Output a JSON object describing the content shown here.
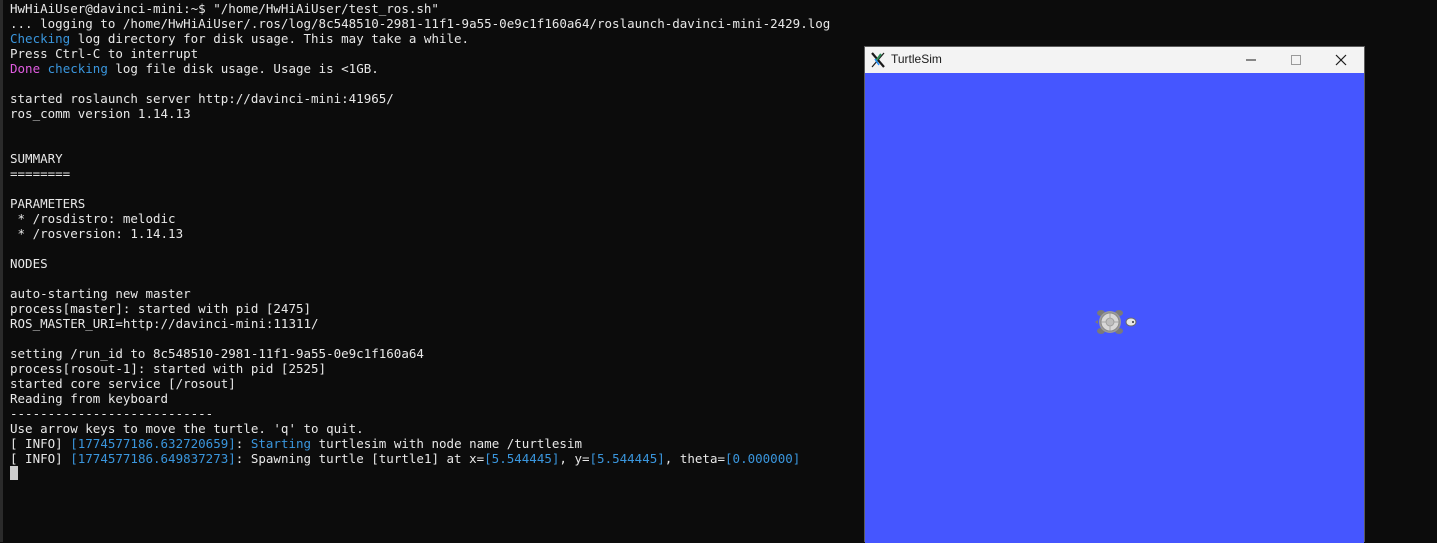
{
  "terminal": {
    "lines": [
      [
        {
          "t": "HwHiAiUser@davinci-mini:~$ \"/home/HwHiAiUser/test_ros.sh\"",
          "c": "normal"
        }
      ],
      [
        {
          "t": "... logging to /home/HwHiAiUser/.ros/log/8c548510-2981-11f1-9a55-0e9c1f160a64/roslaunch-davinci-mini-2429.log",
          "c": "normal"
        }
      ],
      [
        {
          "t": "Checking",
          "c": "blue"
        },
        {
          "t": " log directory for disk usage. This may take a while.",
          "c": "normal"
        }
      ],
      [
        {
          "t": "Press Ctrl-C to interrupt",
          "c": "normal"
        }
      ],
      [
        {
          "t": "Done",
          "c": "magenta"
        },
        {
          "t": " ",
          "c": "normal"
        },
        {
          "t": "checking",
          "c": "blue"
        },
        {
          "t": " log file disk usage. Usage is <1GB.",
          "c": "normal"
        }
      ],
      [
        {
          "t": "",
          "c": "normal"
        }
      ],
      [
        {
          "t": "started roslaunch server http://davinci-mini:41965/",
          "c": "normal"
        }
      ],
      [
        {
          "t": "ros_comm version 1.14.13",
          "c": "normal"
        }
      ],
      [
        {
          "t": "",
          "c": "normal"
        }
      ],
      [
        {
          "t": "",
          "c": "normal"
        }
      ],
      [
        {
          "t": "SUMMARY",
          "c": "normal"
        }
      ],
      [
        {
          "t": "========",
          "c": "normal"
        }
      ],
      [
        {
          "t": "",
          "c": "normal"
        }
      ],
      [
        {
          "t": "PARAMETERS",
          "c": "normal"
        }
      ],
      [
        {
          "t": " * /rosdistro: melodic",
          "c": "normal"
        }
      ],
      [
        {
          "t": " * /rosversion: 1.14.13",
          "c": "normal"
        }
      ],
      [
        {
          "t": "",
          "c": "normal"
        }
      ],
      [
        {
          "t": "NODES",
          "c": "normal"
        }
      ],
      [
        {
          "t": "",
          "c": "normal"
        }
      ],
      [
        {
          "t": "auto-starting new master",
          "c": "normal"
        }
      ],
      [
        {
          "t": "process[master]: started with pid [2475]",
          "c": "normal"
        }
      ],
      [
        {
          "t": "ROS_MASTER_URI=http://davinci-mini:11311/",
          "c": "normal"
        }
      ],
      [
        {
          "t": "",
          "c": "normal"
        }
      ],
      [
        {
          "t": "setting /run_id to 8c548510-2981-11f1-9a55-0e9c1f160a64",
          "c": "normal"
        }
      ],
      [
        {
          "t": "process[rosout-1]: started with pid [2525]",
          "c": "normal"
        }
      ],
      [
        {
          "t": "started core service [/rosout]",
          "c": "normal"
        }
      ],
      [
        {
          "t": "Reading from keyboard",
          "c": "normal"
        }
      ],
      [
        {
          "t": "---------------------------",
          "c": "normal"
        }
      ],
      [
        {
          "t": "Use arrow keys to move the turtle. 'q' to quit.",
          "c": "normal"
        }
      ],
      [
        {
          "t": "[ INFO] ",
          "c": "normal"
        },
        {
          "t": "[1774577186.632720659]",
          "c": "blue"
        },
        {
          "t": ": ",
          "c": "normal"
        },
        {
          "t": "Starting",
          "c": "blue"
        },
        {
          "t": " turtlesim with node name /turtlesim",
          "c": "normal"
        }
      ],
      [
        {
          "t": "[ INFO] ",
          "c": "normal"
        },
        {
          "t": "[1774577186.649837273]",
          "c": "blue"
        },
        {
          "t": ": Spawning turtle [turtle1] at x=",
          "c": "normal"
        },
        {
          "t": "[5.544445]",
          "c": "blue"
        },
        {
          "t": ", y=",
          "c": "normal"
        },
        {
          "t": "[5.544445]",
          "c": "blue"
        },
        {
          "t": ", theta=",
          "c": "normal"
        },
        {
          "t": "[0.000000]",
          "c": "blue"
        }
      ]
    ]
  },
  "turtlesim": {
    "title": "TurtleSim",
    "minimize_icon": "minimize-icon",
    "maximize_icon": "maximize-icon",
    "close_icon": "close-icon",
    "background_color": "#4556ff"
  },
  "colors": {
    "terminal_bg": "#0c0c0c",
    "text": "#e8e8e8",
    "blue": "#3a96dd",
    "magenta": "#e05ce0"
  }
}
